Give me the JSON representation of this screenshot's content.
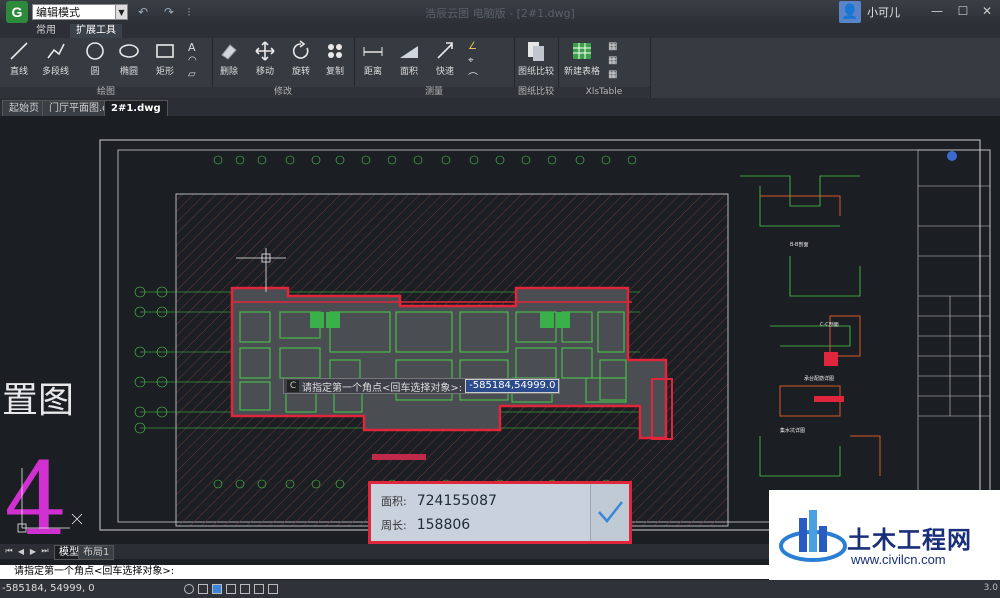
{
  "titlebar": {
    "app_logo": "G",
    "mode_select_value": "编辑模式",
    "window_title": "浩辰云图 电脑版 - [2#1.dwg]",
    "user_name": "小可儿",
    "icons": [
      "undo-icon",
      "redo-icon",
      "user-avatar-icon",
      "minimize-icon",
      "maximize-icon",
      "close-icon"
    ]
  },
  "ribbon_tabs": [
    "常用",
    "扩展工具"
  ],
  "ribbon": {
    "groups": [
      {
        "label": "绘图",
        "buttons": [
          "直线",
          "多段线",
          "圆",
          "椭圆",
          "矩形"
        ]
      },
      {
        "label": "修改",
        "buttons": [
          "删除",
          "移动",
          "旋转",
          "复制"
        ]
      },
      {
        "label": "测量",
        "buttons": [
          "距离",
          "面积",
          "快速"
        ]
      },
      {
        "label": "图纸比较",
        "buttons": [
          "图纸比较"
        ]
      },
      {
        "label": "XlsTable",
        "buttons": [
          "新建表格"
        ]
      }
    ]
  },
  "doc_tabs": [
    "起始页",
    "门厅平面图.dwg",
    "2#1.dwg"
  ],
  "drawing": {
    "left_text": "置图",
    "big_number": "4",
    "prompt_icon": "C",
    "prompt_text": "请指定第一个角点<回车选择对象>:",
    "prompt_input": "-585184,54999.0"
  },
  "measure_result": {
    "area_label": "面积:",
    "area_value": "724155087",
    "perimeter_label": "周长:",
    "perimeter_value": "158806",
    "accent_color": "#e0263a"
  },
  "layout_tabs": [
    "模型",
    "布局1"
  ],
  "command_line": "请指定第一个角点<回车选择对象>:",
  "status": {
    "coordinates": "-585184, 54999, 0",
    "version": "3.0"
  },
  "watermark": {
    "title": "土木工程网",
    "url": "www.civilcn.com"
  }
}
